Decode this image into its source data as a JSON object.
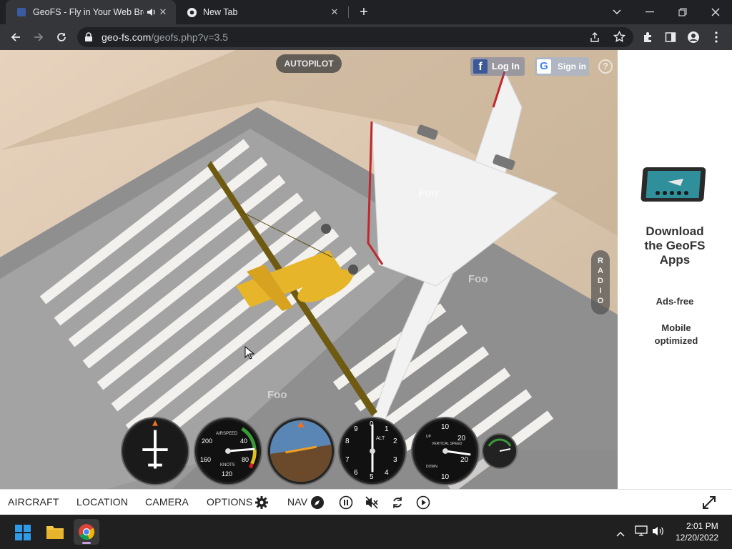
{
  "browser": {
    "tabs": [
      {
        "title": "GeoFS - Fly in Your Web Browser",
        "active": true
      },
      {
        "title": "New Tab",
        "active": false
      }
    ],
    "url_host": "geo-fs.com",
    "url_path": "/geofs.php?v=3.5"
  },
  "sim": {
    "autopilot_label": "AUTOPILOT",
    "fb_login_label": "Log In",
    "google_signin_label": "Sign in",
    "help_label": "?",
    "radio_label": "RADIO",
    "overlay_labels": [
      "Foo",
      "Foo",
      "Foo"
    ],
    "gauges": {
      "airspeed_title": "AIRSPEED",
      "airspeed_unit": "KNOTS",
      "airspeed_ticks": [
        "40",
        "80",
        "120",
        "160",
        "200"
      ],
      "altimeter_title": "ALT",
      "altimeter_ticks": [
        "0",
        "1",
        "2",
        "3",
        "4",
        "5",
        "6",
        "7",
        "8",
        "9"
      ],
      "vs_title": "VERTICAL SPEED",
      "vs_ticks": [
        "10",
        "20",
        "10",
        "20"
      ],
      "vs_up": "UP",
      "vs_down": "DOWN"
    }
  },
  "ad": {
    "title": "Download the GeoFS Apps",
    "line1": "Ads-free",
    "line2": "Mobile optimized"
  },
  "bottom_menu": {
    "aircraft": "AIRCRAFT",
    "location": "LOCATION",
    "camera": "CAMERA",
    "options": "OPTIONS",
    "nav": "NAV"
  },
  "taskbar": {
    "time": "2:01 PM",
    "date": "12/20/2022"
  },
  "colors": {
    "accent": "#e8eaed",
    "sim_yellow": "#e6b52a",
    "concorde_white": "#f2f2f2"
  }
}
